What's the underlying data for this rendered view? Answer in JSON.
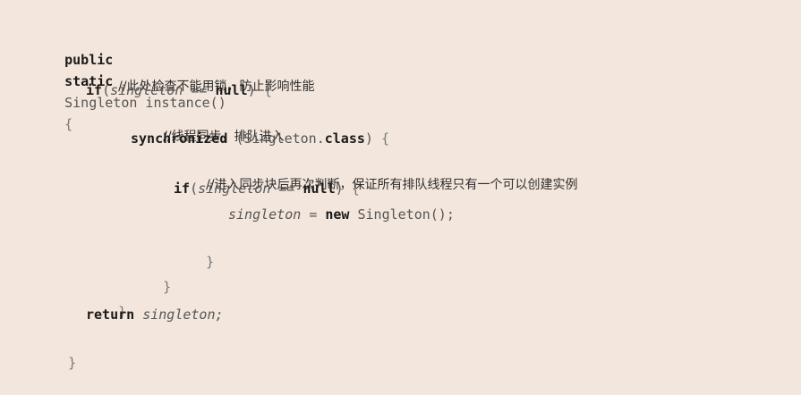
{
  "code": {
    "line1": {
      "kw1": "public",
      "kw2": "static",
      "signature": "Singleton instance()",
      "brace": "{"
    },
    "line2": {
      "comment": "//此处检查不能用锁，防止影响性能"
    },
    "line3": {
      "kw": "if",
      "paren_open": "(",
      "var": "singleton",
      "op": "==",
      "null": "null",
      "paren_close": ")",
      "brace": "{"
    },
    "line4": {
      "comment": "//线程同步，排队进入"
    },
    "line5": {
      "kw": "synchronized",
      "arg_open": "(Singleton.",
      "class_kw": "class",
      "arg_close": ")",
      "brace": "{"
    },
    "line6": {
      "comment": "//进入同步块后再次判断，保证所有排队线程只有一个可以创建实例"
    },
    "line7": {
      "kw": "if",
      "paren_open": "(",
      "var": "singleton",
      "op": "==",
      "null": "null",
      "paren_close": ")",
      "brace": "{"
    },
    "line8": {
      "var": "singleton",
      "op": "=",
      "new_kw": "new",
      "ctor": "Singleton();"
    },
    "line9": {
      "brace": "}"
    },
    "line10": {
      "brace": "}"
    },
    "line11": {
      "brace": "}"
    },
    "line12": {
      "kw": "return",
      "var": "singleton;"
    },
    "line13": {
      "brace": "}"
    }
  }
}
